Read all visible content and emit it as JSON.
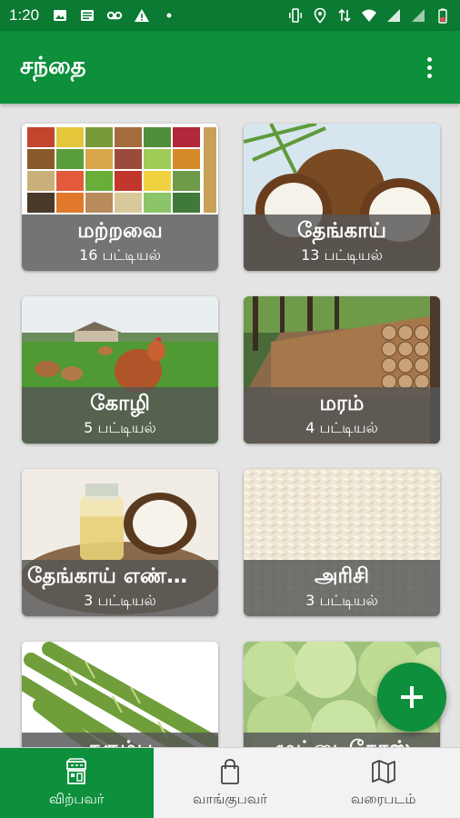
{
  "status_bar": {
    "time": "1:20",
    "icons_left": [
      "image-icon",
      "news-icon",
      "voicemail-icon",
      "warning-icon",
      "dot-icon"
    ],
    "icons_right": [
      "vibrate-icon",
      "location-icon",
      "data-icon",
      "wifi-icon",
      "signal-icon",
      "signal-icon",
      "battery-icon"
    ]
  },
  "app_bar": {
    "title": "சந்தை",
    "menu_icon": "more-vert-icon"
  },
  "categories": [
    {
      "title": "மற்றவை",
      "count": "16 பட்டியல்"
    },
    {
      "title": "தேங்காய்",
      "count": "13 பட்டியல்"
    },
    {
      "title": "கோழி",
      "count": "5 பட்டியல்"
    },
    {
      "title": "மரம்",
      "count": "4 பட்டியல்"
    },
    {
      "title": "தேங்காய் எண்ணெய்",
      "count": "3 பட்டியல்"
    },
    {
      "title": "அரிசி",
      "count": "3 பட்டியல்"
    },
    {
      "title": "கரும்பு",
      "count": ""
    },
    {
      "title": "முட்டைகோஸ்",
      "count": ""
    }
  ],
  "fab": {
    "icon": "plus-icon"
  },
  "bottom_nav": {
    "items": [
      {
        "label": "விற்பவர்",
        "icon": "seller-icon",
        "active": true
      },
      {
        "label": "வாங்குபவர்",
        "icon": "shopping-bag-icon",
        "active": false
      },
      {
        "label": "வரைபடம்",
        "icon": "map-icon",
        "active": false
      }
    ]
  },
  "colors": {
    "primary": "#0d8f3c",
    "status_bar": "#0b7a32",
    "background": "#e4e4e4",
    "overlay": "#555555"
  }
}
